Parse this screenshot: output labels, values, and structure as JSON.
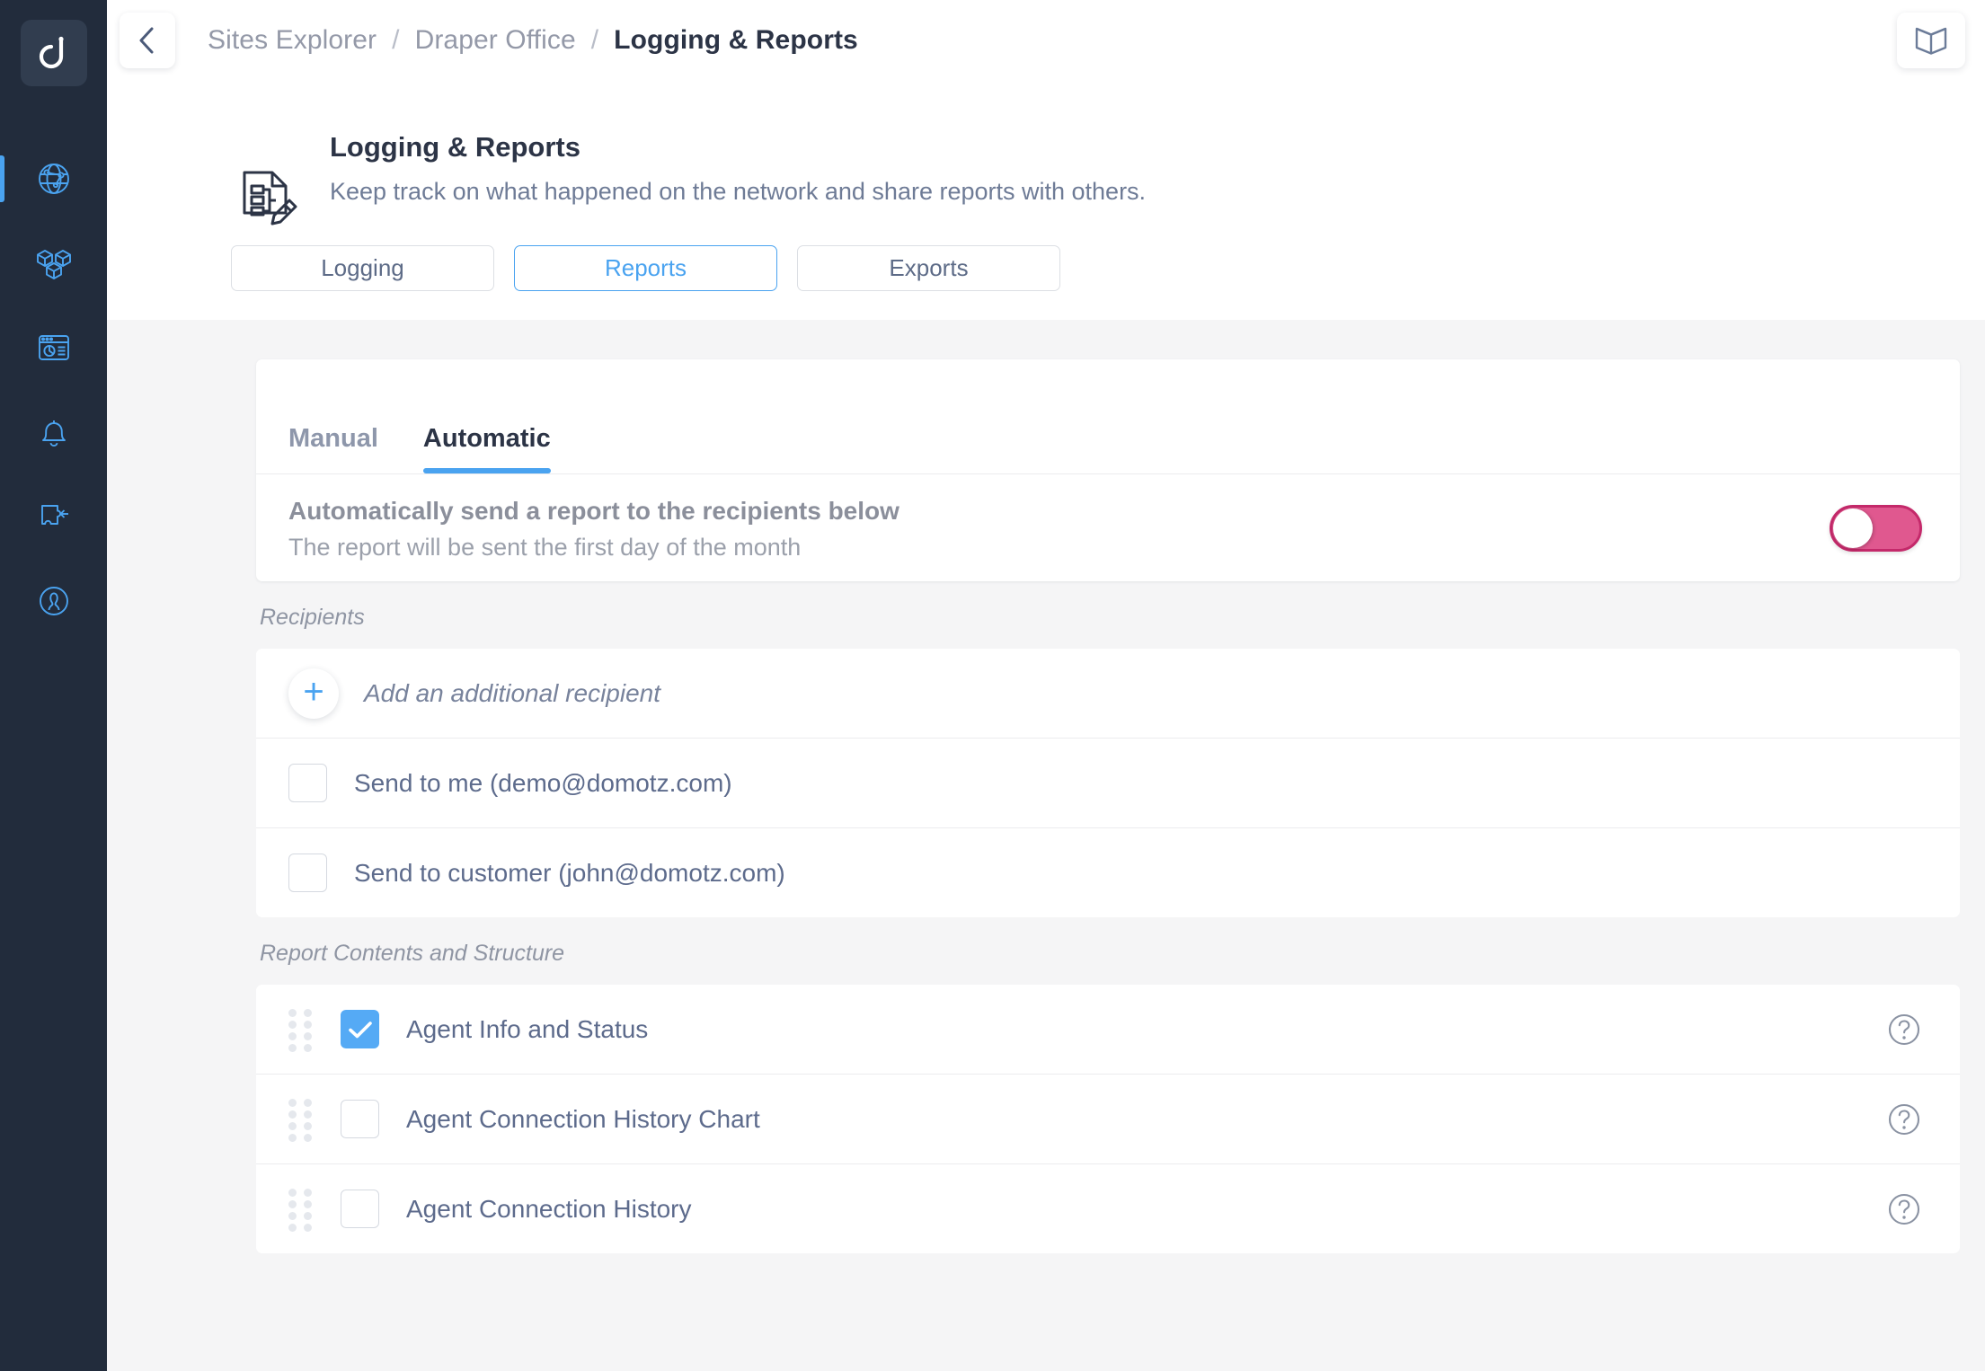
{
  "sidebar": {
    "brand": {
      "name": "domotz-logo",
      "letter": "d"
    },
    "items": [
      {
        "icon": "globe-network-icon",
        "label": "Network",
        "active": true
      },
      {
        "icon": "cubes-inventory-icon",
        "label": "Inventory",
        "active": false
      },
      {
        "icon": "dashboard-report-icon",
        "label": "Dashboard",
        "active": false
      },
      {
        "icon": "bell-alerts-icon",
        "label": "Alerts",
        "active": false
      },
      {
        "icon": "puzzle-integrations-icon",
        "label": "Integrations",
        "active": false
      },
      {
        "icon": "user-account-icon",
        "label": "Account",
        "active": false
      }
    ]
  },
  "topbar": {
    "back_button": "back-arrow-icon",
    "book_button": "open-book-icon",
    "breadcrumb": [
      {
        "label": "Sites Explorer",
        "current": false
      },
      {
        "label": "Draper Office",
        "current": false
      },
      {
        "label": "Logging & Reports",
        "current": true
      }
    ],
    "separator": "/"
  },
  "page": {
    "icon": "document-pencil-icon",
    "title": "Logging & Reports",
    "subtitle": "Keep track on what happened on the network and share reports with others."
  },
  "tabs": [
    {
      "label": "Logging",
      "selected": false
    },
    {
      "label": "Reports",
      "selected": true
    },
    {
      "label": "Exports",
      "selected": false
    }
  ],
  "subtabs": [
    {
      "label": "Manual",
      "active": false
    },
    {
      "label": "Automatic",
      "active": true
    }
  ],
  "auto_report": {
    "title": "Automatically send a report to the recipients below",
    "subtitle": "The report will be sent the first day of the month",
    "toggle": {
      "name": "auto-report-toggle",
      "on": false,
      "color": "#e0588f",
      "border_color": "#c4296a"
    }
  },
  "recipients": {
    "section_label": "Recipients",
    "add_label": "Add an additional recipient",
    "items": [
      {
        "label": "Send to me (demo@domotz.com)",
        "checked": false
      },
      {
        "label": "Send to customer (john@domotz.com)",
        "checked": false
      }
    ]
  },
  "report_contents": {
    "section_label": "Report Contents and Structure",
    "items": [
      {
        "label": "Agent Info and Status",
        "checked": true,
        "help": "?"
      },
      {
        "label": "Agent Connection History Chart",
        "checked": false,
        "help": "?"
      },
      {
        "label": "Agent Connection History",
        "checked": false,
        "help": "?"
      }
    ]
  },
  "colors": {
    "accent_blue": "#4aa3f0",
    "checkbox_blue": "#55aaf5",
    "toggle_pink": "#e0588f",
    "sidebar_dark": "#222c3c",
    "page_bg": "#f5f5f6",
    "text_dark": "#2c3446",
    "text_muted": "#8f95a3",
    "label_blue_gray": "#5d6b8c"
  }
}
